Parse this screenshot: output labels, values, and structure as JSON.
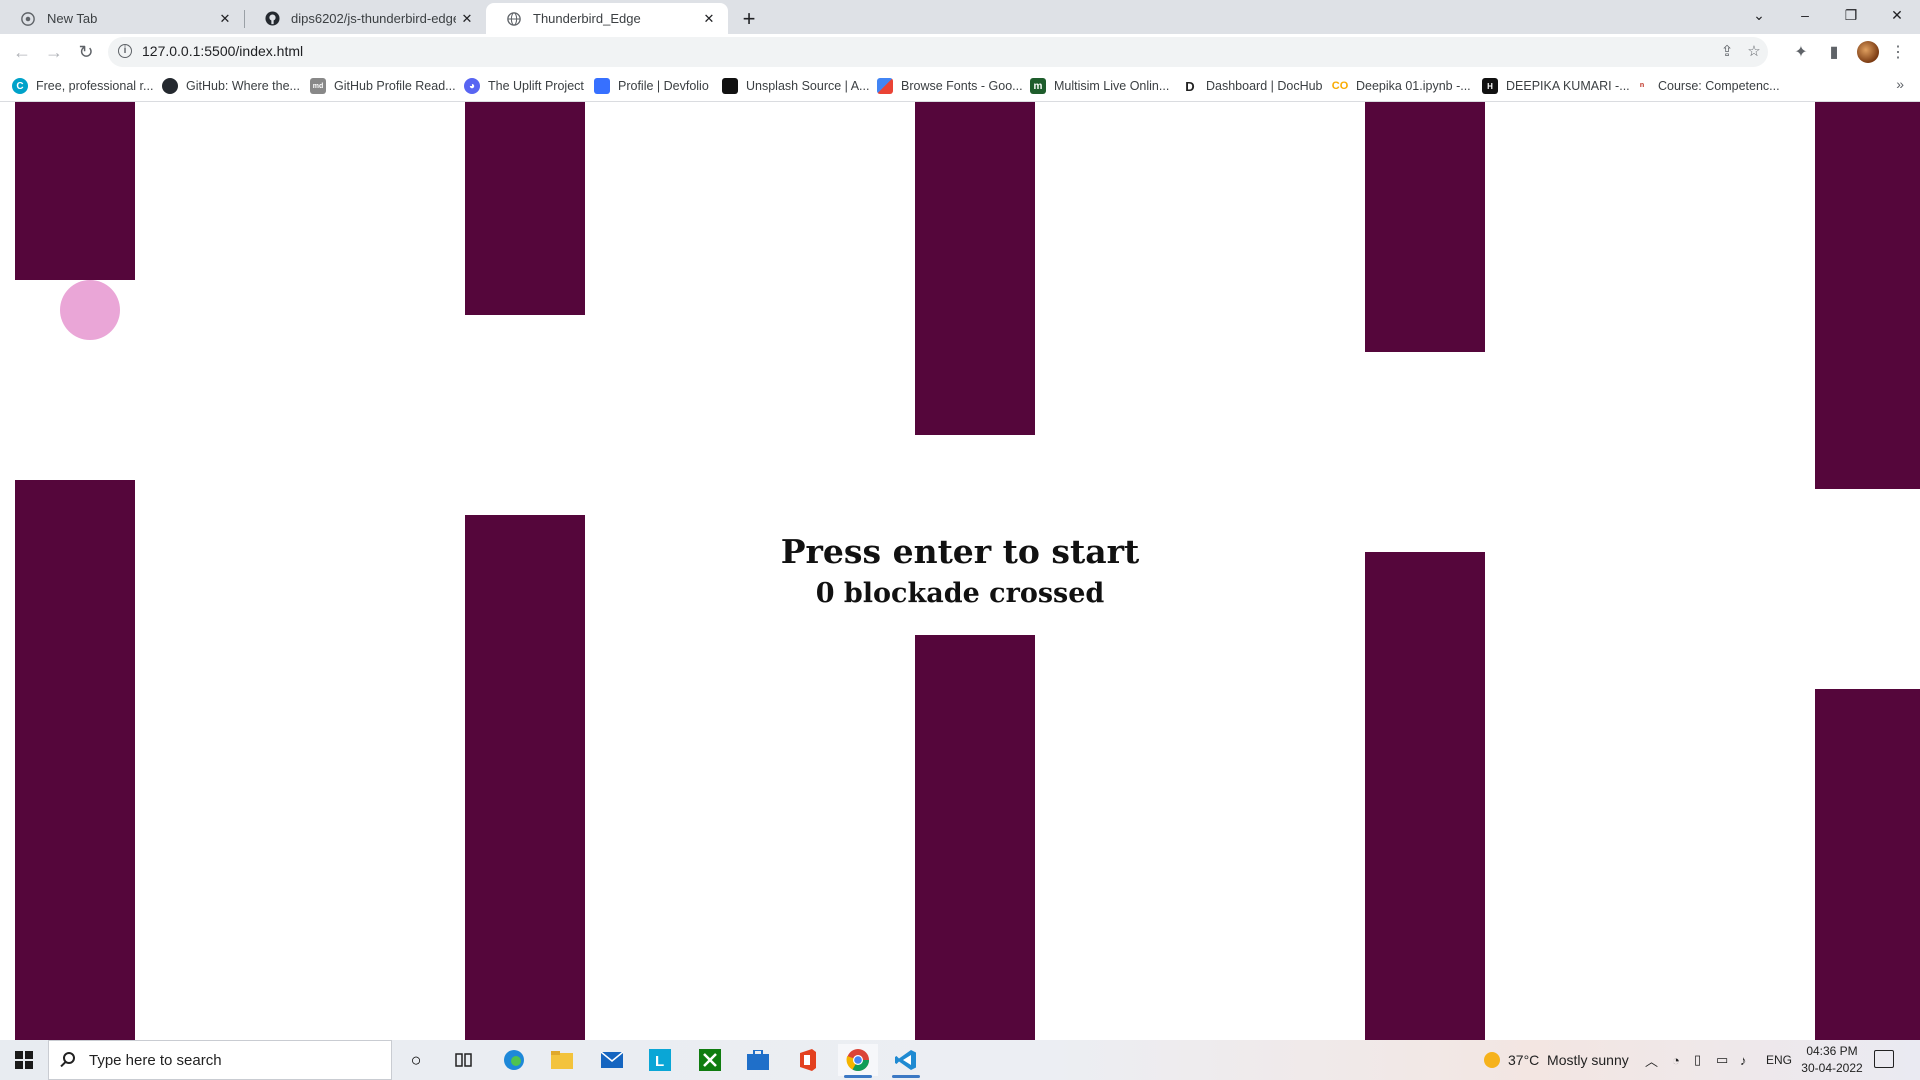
{
  "browser": {
    "tabs": [
      {
        "label": "New Tab",
        "icon": "chrome-icon",
        "active": false
      },
      {
        "label": "dips6202/js-thunderbird-edge",
        "icon": "github-icon",
        "active": false
      },
      {
        "label": "Thunderbird_Edge",
        "icon": "globe-icon",
        "active": true
      }
    ],
    "url": "127.0.0.1:5500/index.html",
    "bookmarks": [
      {
        "label": "Free, professional r...",
        "icon": "canva-icon",
        "color": "#00a2c9"
      },
      {
        "label": "GitHub: Where the...",
        "icon": "github-icon",
        "color": "#24292f"
      },
      {
        "label": "GitHub Profile Read...",
        "icon": "readme-icon",
        "color": "#555555"
      },
      {
        "label": "The Uplift Project",
        "icon": "discord-icon",
        "color": "#5865f2"
      },
      {
        "label": "Profile | Devfolio",
        "icon": "devfolio-icon",
        "color": "#3770ff"
      },
      {
        "label": "Unsplash Source | A...",
        "icon": "unsplash-icon",
        "color": "#111111"
      },
      {
        "label": "Browse Fonts - Goo...",
        "icon": "google-fonts-icon",
        "color": "#4285f4"
      },
      {
        "label": "Multisim Live Onlin...",
        "icon": "multisim-icon",
        "color": "#1e5d2c"
      },
      {
        "label": "Dashboard | DocHub",
        "icon": "dochub-icon",
        "color": "#222222"
      },
      {
        "label": "Deepika 01.ipynb -...",
        "icon": "colab-icon",
        "color": "#f9ab00"
      },
      {
        "label": "DEEPIKA KUMARI -...",
        "icon": "hackerearth-icon",
        "color": "#111111"
      },
      {
        "label": "Course: Competenc...",
        "icon": "course-icon",
        "color": "#c0392b"
      }
    ]
  },
  "game": {
    "start_message": "Press enter to start",
    "score_count": "0",
    "score_suffix": "blockade crossed",
    "pipe_color": "#55063b",
    "bird_color": "#eaa6d7"
  },
  "taskbar": {
    "search_placeholder": "Type here to search",
    "weather": "37°C  Mostly sunny",
    "language": "ENG",
    "time": "04:36 PM",
    "date": "30-04-2022"
  }
}
